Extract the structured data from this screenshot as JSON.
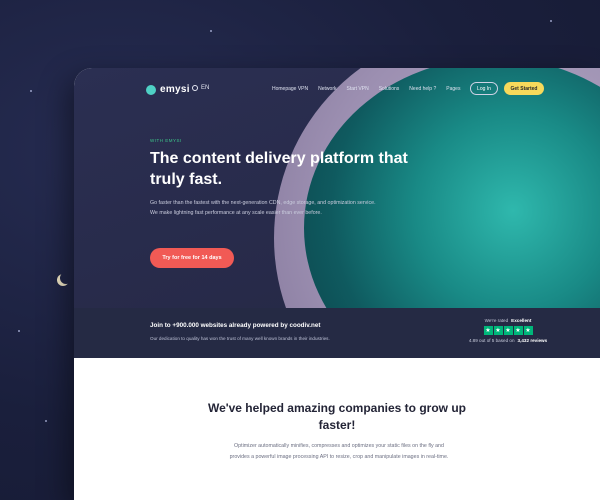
{
  "brand": {
    "logo_text": "emysi",
    "language": "EN"
  },
  "nav": {
    "items": [
      "Homepage VPN",
      "Network",
      "Start VPN",
      "Solutions",
      "Need help ?",
      "Pages"
    ],
    "login_label": "Log In",
    "start_label": "Get Started"
  },
  "hero": {
    "eyebrow": "WITH EMYSI",
    "headline": "The content delivery platform that truly fast.",
    "subtext": "Go faster than the fastest with the next-generation CDN, edge storage, and optimization service. We make lightning fast performance at any scale easier than ever before.",
    "cta_label": "Try for free for 14 days"
  },
  "trust": {
    "title": "Join to +900.000 websites already powered by coodiv.net",
    "subtitle": "Our dedication to quality has won the trust of many well known brands in their industries.",
    "rated_prefix": "We're rated",
    "rating_word": "Excellent",
    "score_text": "4.89 out of 5 based on",
    "reviews_text": "3,432 reviews",
    "stars": "★"
  },
  "section": {
    "title": "We've helped amazing companies to grow up faster!",
    "body": "Optimizer automatically minifies, compresses and optimizes your static files on the fly and provides a powerful image processing API to resize, crop and manipulate images in real-time."
  },
  "colors": {
    "accent_yellow": "#f7d95b",
    "cta_red": "#f15a55",
    "eyebrow_green": "#3ec58a",
    "trustpilot_green": "#00b67a"
  }
}
